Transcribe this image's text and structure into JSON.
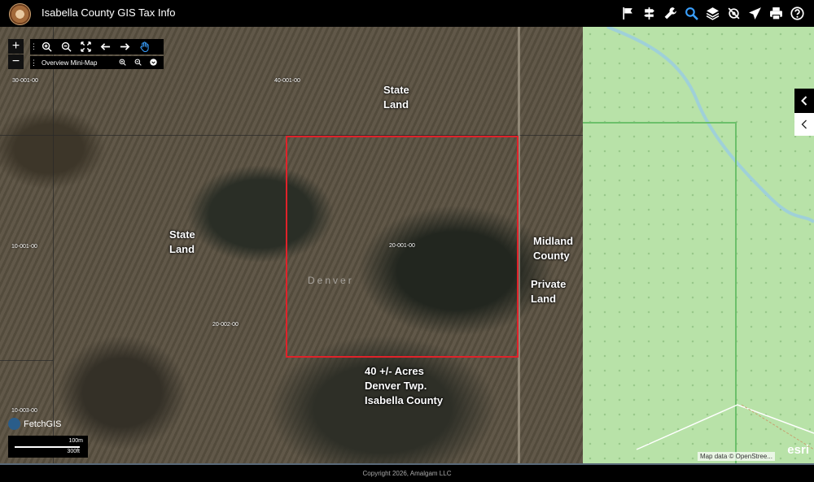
{
  "header": {
    "title": "Isabella County GIS Tax Info",
    "tools": [
      "flag-icon",
      "signpost-icon",
      "wrench-icon",
      "search-icon",
      "layers-icon",
      "gps-icon",
      "send-icon",
      "print-icon",
      "help-icon"
    ],
    "accent_color": "#3aa0ff"
  },
  "map_controls": {
    "zoom_in": "+",
    "zoom_out": "−",
    "overview_label": "Overview Mini-Map"
  },
  "map": {
    "parcel_ids": {
      "nw": "30-001-00",
      "n": "40-001-00",
      "w": "10-001-00",
      "center": "20-001-00",
      "sw_center": "20-002-00",
      "sw": "10-003-00"
    },
    "township_watermark": "Denver",
    "labels": {
      "state_land_1_a": "State",
      "state_land_1_b": "Land",
      "state_land_2_a": "State",
      "state_land_2_b": "Land",
      "midland_a": "Midland",
      "midland_b": "County",
      "private_a": "Private",
      "private_b": "Land",
      "desc_1": "40 +/- Acres",
      "desc_2": "Denver Twp.",
      "desc_3": "Isabella County"
    },
    "subject_color": "#e0222a"
  },
  "branding": {
    "name": "FetchGIS"
  },
  "scale": {
    "metric": "100m",
    "imperial": "300ft"
  },
  "attribution": "Map data © OpenStree...",
  "esri": "esri",
  "footer": {
    "copyright": "Copyright 2026, Amalgam LLC"
  }
}
